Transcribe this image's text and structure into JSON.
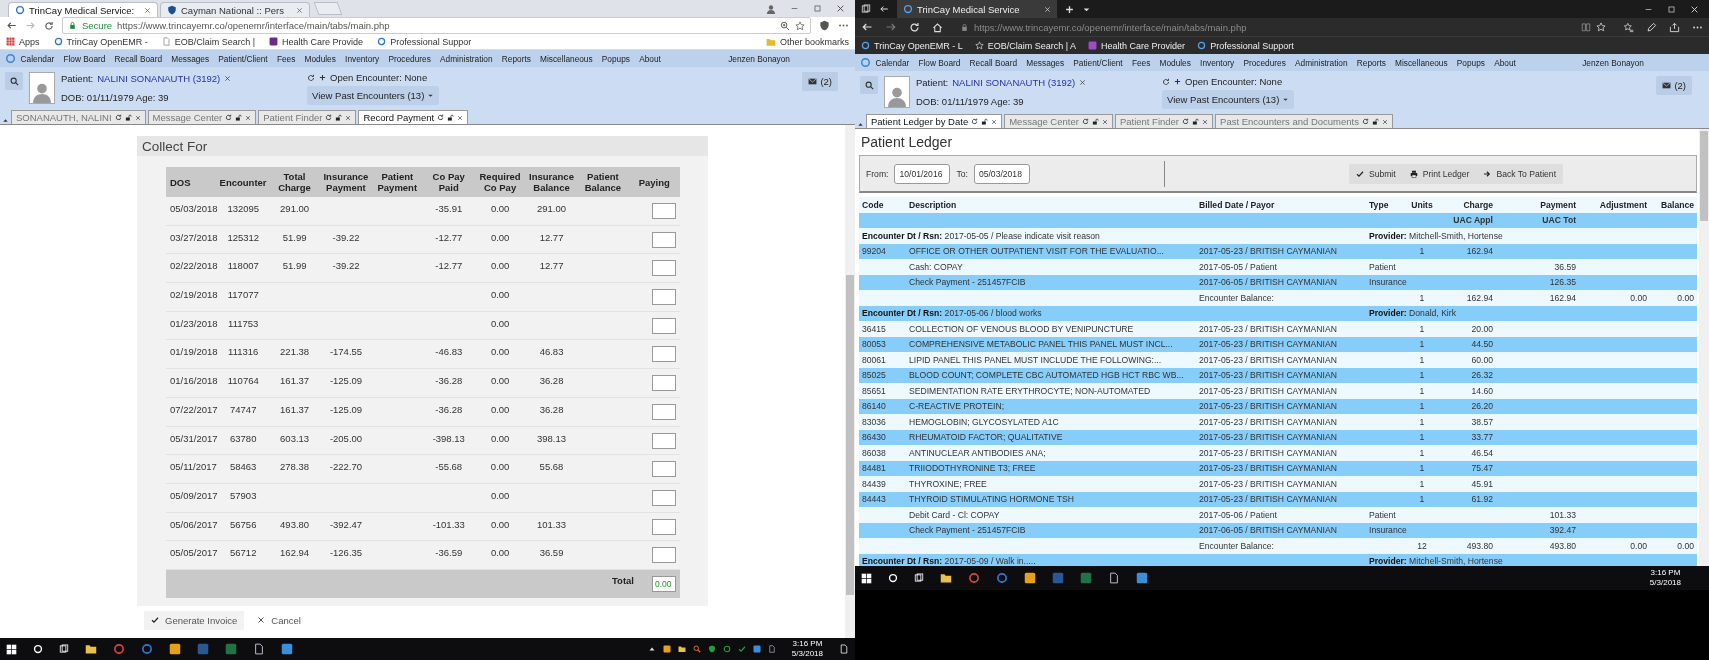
{
  "windows": [
    {
      "kind": "chrome",
      "browser_tabs": [
        {
          "title": "TrinCay Medical Service:",
          "selected": true
        },
        {
          "title": "Cayman National :: Pers",
          "selected": false
        }
      ],
      "address": {
        "secure_label": "Secure",
        "url": "https://www.trincayemr.co/openemr/interface/main/tabs/main.php"
      },
      "bookmarks": [
        "Apps",
        "TrinCay OpenEMR -",
        "EOB/Claim Search |",
        "Health Care Provide",
        "Professional Suppor"
      ],
      "other_bookmarks": "Other bookmarks",
      "emr": {
        "menu": [
          "Calendar",
          "Flow Board",
          "Recall Board",
          "Messages",
          "Patient/Client",
          "Fees",
          "Modules",
          "Inventory",
          "Procedures",
          "Administration",
          "Reports",
          "Miscellaneous",
          "Popups",
          "About"
        ],
        "user": "Jenzen Bonayon",
        "patient": {
          "label": "Patient:",
          "name": "NALINI SONANAUTH (3192)",
          "dob": "DOB: 01/11/1979 Age: 39"
        },
        "encounter": {
          "open": "Open Encounter: None",
          "past": "View Past Encounters  (13)"
        },
        "messages": "(2)",
        "tabs": [
          {
            "label": "SONANAUTH, NALINI",
            "selected": false
          },
          {
            "label": "Message Center",
            "selected": false
          },
          {
            "label": "Patient Finder",
            "selected": false
          },
          {
            "label": "Record Payment",
            "selected": true
          }
        ]
      },
      "page": {
        "kind": "collect",
        "title": "Collect For",
        "columns": [
          "DOS",
          "Encounter",
          "Total Charge",
          "Insurance Payment",
          "Patient Payment",
          "Co Pay Paid",
          "Required Co Pay",
          "Insurance Balance",
          "Patient Balance",
          "Paying"
        ],
        "rows": [
          {
            "dos": "05/03/2018",
            "encounter": "132095",
            "total_charge": "291.00",
            "copay_paid": "-35.91",
            "required_copay": "0.00",
            "insurance_balance": "291.00"
          },
          {
            "dos": "03/27/2018",
            "encounter": "125312",
            "total_charge": "51.99",
            "insurance_payment": "-39.22",
            "copay_paid": "-12.77",
            "required_copay": "0.00",
            "insurance_balance": "12.77"
          },
          {
            "dos": "02/22/2018",
            "encounter": "118007",
            "total_charge": "51.99",
            "insurance_payment": "-39.22",
            "copay_paid": "-12.77",
            "required_copay": "0.00",
            "insurance_balance": "12.77"
          },
          {
            "dos": "02/19/2018",
            "encounter": "117077",
            "required_copay": "0.00"
          },
          {
            "dos": "01/23/2018",
            "encounter": "111753",
            "required_copay": "0.00"
          },
          {
            "dos": "01/19/2018",
            "encounter": "111316",
            "total_charge": "221.38",
            "insurance_payment": "-174.55",
            "copay_paid": "-46.83",
            "required_copay": "0.00",
            "insurance_balance": "46.83"
          },
          {
            "dos": "01/16/2018",
            "encounter": "110764",
            "total_charge": "161.37",
            "insurance_payment": "-125.09",
            "copay_paid": "-36.28",
            "required_copay": "0.00",
            "insurance_balance": "36.28"
          },
          {
            "dos": "07/22/2017",
            "encounter": "74747",
            "total_charge": "161.37",
            "insurance_payment": "-125.09",
            "copay_paid": "-36.28",
            "required_copay": "0.00",
            "insurance_balance": "36.28"
          },
          {
            "dos": "05/31/2017",
            "encounter": "63780",
            "total_charge": "603.13",
            "insurance_payment": "-205.00",
            "copay_paid": "-398.13",
            "required_copay": "0.00",
            "insurance_balance": "398.13"
          },
          {
            "dos": "05/11/2017",
            "encounter": "58463",
            "total_charge": "278.38",
            "insurance_payment": "-222.70",
            "copay_paid": "-55.68",
            "required_copay": "0.00",
            "insurance_balance": "55.68"
          },
          {
            "dos": "05/09/2017",
            "encounter": "57903",
            "required_copay": "0.00"
          },
          {
            "dos": "05/06/2017",
            "encounter": "56756",
            "total_charge": "493.80",
            "insurance_payment": "-392.47",
            "copay_paid": "-101.33",
            "required_copay": "0.00",
            "insurance_balance": "101.33"
          },
          {
            "dos": "05/05/2017",
            "encounter": "56712",
            "total_charge": "162.94",
            "insurance_payment": "-126.35",
            "copay_paid": "-36.59",
            "required_copay": "0.00",
            "insurance_balance": "36.59"
          }
        ],
        "total_label": "Total",
        "total_value": "0.00",
        "buttons": [
          "Generate Invoice",
          "Cancel"
        ]
      },
      "taskbar": {
        "time": "3:16 PM",
        "date": "5/3/2018"
      }
    },
    {
      "kind": "edge",
      "browser_tabs": [
        {
          "title": "TrinCay Medical Service",
          "selected": true
        }
      ],
      "address": {
        "url": "https://www.trincayemr.co/openemr/interface/main/tabs/main.php"
      },
      "bookmarks": [
        "TrinCay OpenEMR - L",
        "EOB/Claim Search | A",
        "Health Care Provider",
        "Professional Support"
      ],
      "emr": {
        "menu": [
          "Calendar",
          "Flow Board",
          "Recall Board",
          "Messages",
          "Patient/Client",
          "Fees",
          "Modules",
          "Inventory",
          "Procedures",
          "Administration",
          "Reports",
          "Miscellaneous",
          "Popups",
          "About"
        ],
        "user": "Jenzen Bonayon",
        "patient": {
          "label": "Patient:",
          "name": "NALINI SONANAUTH (3192)",
          "dob": "DOB: 01/11/1979 Age: 39"
        },
        "encounter": {
          "open": "Open Encounter: None",
          "past": "View Past Encounters  (13)"
        },
        "messages": "(2)",
        "tabs": [
          {
            "label": "Patient Ledger by Date",
            "selected": true
          },
          {
            "label": "Message Center",
            "selected": false
          },
          {
            "label": "Patient Finder",
            "selected": false
          },
          {
            "label": "Past Encounters and Documents",
            "selected": false
          }
        ]
      },
      "page": {
        "kind": "ledger",
        "title": "Patient Ledger",
        "from_label": "From:",
        "from": "10/01/2016",
        "to_label": "To:",
        "to": "05/03/2018",
        "buttons": [
          "Submit",
          "Print Ledger",
          "Back To Patient"
        ],
        "columns": [
          "Code",
          "Description",
          "Billed Date / Payor",
          "Type",
          "Units",
          "Charge",
          "Payment",
          "Adjustment",
          "Balance"
        ],
        "rows": [
          {
            "kind": "subheader",
            "charge": "UAC Appl",
            "payment": "UAC Tot"
          },
          {
            "kind": "encounter",
            "reason": "**Encounter Dt / Rsn:** 2017-05-05 / Please indicate visit reason",
            "provider": "**Provider:** Mitchell-Smith, Hortense"
          },
          {
            "kind": "item",
            "code": "99204",
            "description": "OFFICE OR OTHER OUTPATIENT VISIT FOR THE EVALUATIO...",
            "billed": "2017-05-23 /  BRITISH CAYMANIAN",
            "units": "1",
            "charge": "162.94"
          },
          {
            "kind": "item",
            "description": "Cash: COPAY",
            "billed": "2017-05-05 / Patient",
            "type": "Patient",
            "payment": "36.59"
          },
          {
            "kind": "item",
            "description": "Check Payment - 251457FCIB",
            "billed": "2017-06-05 /  BRITISH CAYMANIAN",
            "type": "Insurance",
            "payment": "126.35"
          },
          {
            "kind": "item",
            "billed": "Encounter Balance:",
            "units": "1",
            "charge": "162.94",
            "payment": "162.94",
            "adjustment": "0.00",
            "balance": "0.00"
          },
          {
            "kind": "encounter",
            "reason": "**Encounter Dt / Rsn:** 2017-05-06 / blood works",
            "provider": "**Provider:** Donald, Kirk"
          },
          {
            "kind": "item",
            "code": "36415",
            "description": "COLLECTION OF VENOUS BLOOD BY VENIPUNCTURE",
            "billed": "2017-05-23 /  BRITISH CAYMANIAN",
            "units": "1",
            "charge": "20.00"
          },
          {
            "kind": "item",
            "code": "80053",
            "description": "COMPREHENSIVE METABOLIC PANEL THIS PANEL MUST INCL...",
            "billed": "2017-05-23 /  BRITISH CAYMANIAN",
            "units": "1",
            "charge": "44.50"
          },
          {
            "kind": "item",
            "code": "80061",
            "description": "LIPID PANEL THIS PANEL MUST INCLUDE THE FOLLOWING:...",
            "billed": "2017-05-23 /  BRITISH CAYMANIAN",
            "units": "1",
            "charge": "60.00"
          },
          {
            "kind": "item",
            "code": "85025",
            "description": "BLOOD COUNT; COMPLETE CBC AUTOMATED HGB HCT RBC WB...",
            "billed": "2017-05-23 /  BRITISH CAYMANIAN",
            "units": "1",
            "charge": "26.32"
          },
          {
            "kind": "item",
            "code": "85651",
            "description": "SEDIMENTATION RATE ERYTHROCYTE; NON-AUTOMATED",
            "billed": "2017-05-23 /  BRITISH CAYMANIAN",
            "units": "1",
            "charge": "14.60"
          },
          {
            "kind": "item",
            "code": "86140",
            "description": "C-REACTIVE PROTEIN;",
            "billed": "2017-05-23 /  BRITISH CAYMANIAN",
            "units": "1",
            "charge": "26.20"
          },
          {
            "kind": "item",
            "code": "83036",
            "description": "HEMOGLOBIN; GLYCOSYLATED A1C",
            "billed": "2017-05-23 /  BRITISH CAYMANIAN",
            "units": "1",
            "charge": "38.57"
          },
          {
            "kind": "item",
            "code": "86430",
            "description": "RHEUMATOID FACTOR; QUALITATIVE",
            "billed": "2017-05-23 /  BRITISH CAYMANIAN",
            "units": "1",
            "charge": "33.77"
          },
          {
            "kind": "item",
            "code": "86038",
            "description": "ANTINUCLEAR ANTIBODIES ANA;",
            "billed": "2017-05-23 /  BRITISH CAYMANIAN",
            "units": "1",
            "charge": "46.54"
          },
          {
            "kind": "item",
            "code": "84481",
            "description": "TRIIODOTHYRONINE T3; FREE",
            "billed": "2017-05-23 /  BRITISH CAYMANIAN",
            "units": "1",
            "charge": "75.47"
          },
          {
            "kind": "item",
            "code": "84439",
            "description": "THYROXINE; FREE",
            "billed": "2017-05-23 /  BRITISH CAYMANIAN",
            "units": "1",
            "charge": "45.91"
          },
          {
            "kind": "item",
            "code": "84443",
            "description": "THYROID STIMULATING HORMONE TSH",
            "billed": "2017-05-23 /  BRITISH CAYMANIAN",
            "units": "1",
            "charge": "61.92"
          },
          {
            "kind": "item",
            "description": "Debit Card - Cl: COPAY",
            "billed": "2017-05-06 / Patient",
            "type": "Patient",
            "payment": "101.33"
          },
          {
            "kind": "item",
            "description": "Check Payment - 251457FCIB",
            "billed": "2017-06-05 /  BRITISH CAYMANIAN",
            "type": "Insurance",
            "payment": "392.47"
          },
          {
            "kind": "item",
            "billed": "Encounter Balance:",
            "units": "12",
            "charge": "493.80",
            "payment": "493.80",
            "adjustment": "0.00",
            "balance": "0.00"
          },
          {
            "kind": "encounter",
            "reason": "**Encounter Dt / Rsn:** 2017-05-09 / Walk in.....",
            "provider": "**Provider:** Mitchell-Smith, Hortense"
          }
        ]
      },
      "taskbar": {
        "time": "3:16 PM",
        "date": "5/3/2018"
      }
    }
  ]
}
